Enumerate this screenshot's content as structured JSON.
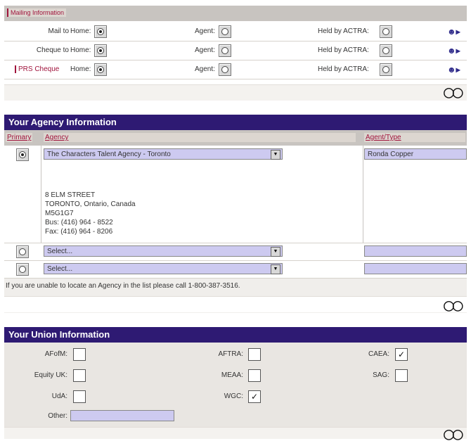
{
  "mailing": {
    "header": "Mailing Information",
    "rows": [
      {
        "label": "Mail to",
        "home": "Home:",
        "agent": "Agent:",
        "held": "Held by ACTRA:",
        "home_checked": true
      },
      {
        "label": "Cheque to",
        "home": "Home:",
        "agent": "Agent:",
        "held": "Held by ACTRA:",
        "home_checked": true
      },
      {
        "label": "PRS Cheque",
        "home": "Home:",
        "agent": "Agent:",
        "held": "Held by ACTRA:",
        "home_checked": true
      }
    ]
  },
  "agency": {
    "title": "Your Agency Information",
    "col_primary": "Primary",
    "col_agency": "Agency",
    "col_agent_type": "Agent/Type",
    "agency_selected": "The Characters Talent Agency - Toronto",
    "agent_name": "Ronda Copper",
    "address": [
      "8 ELM STREET",
      "TORONTO, Ontario, Canada",
      "M5G1G7",
      "Bus: (416) 964 - 8522",
      "Fax: (416) 964 - 8206"
    ],
    "select_placeholder": "Select...",
    "note": "If you are unable to locate an Agency in the list please call 1-800-387-3516."
  },
  "union": {
    "title": "Your Union Information",
    "items": [
      {
        "label": "AFofM:",
        "checked": false
      },
      {
        "label": "AFTRA:",
        "checked": false
      },
      {
        "label": "CAEA:",
        "checked": true
      },
      {
        "label": "Equity UK:",
        "checked": false
      },
      {
        "label": "MEAA:",
        "checked": false
      },
      {
        "label": "SAG:",
        "checked": false
      },
      {
        "label": "UdA:",
        "checked": false
      },
      {
        "label": "WGC:",
        "checked": true
      }
    ],
    "other_label": "Other:",
    "other_value": ""
  },
  "icons": {
    "link": "people-arrow-icon",
    "collapse": "double-chevron-icon"
  },
  "colors": {
    "header": "#2e1a73",
    "accent": "#a0143c",
    "field": "#cdcaf0"
  }
}
